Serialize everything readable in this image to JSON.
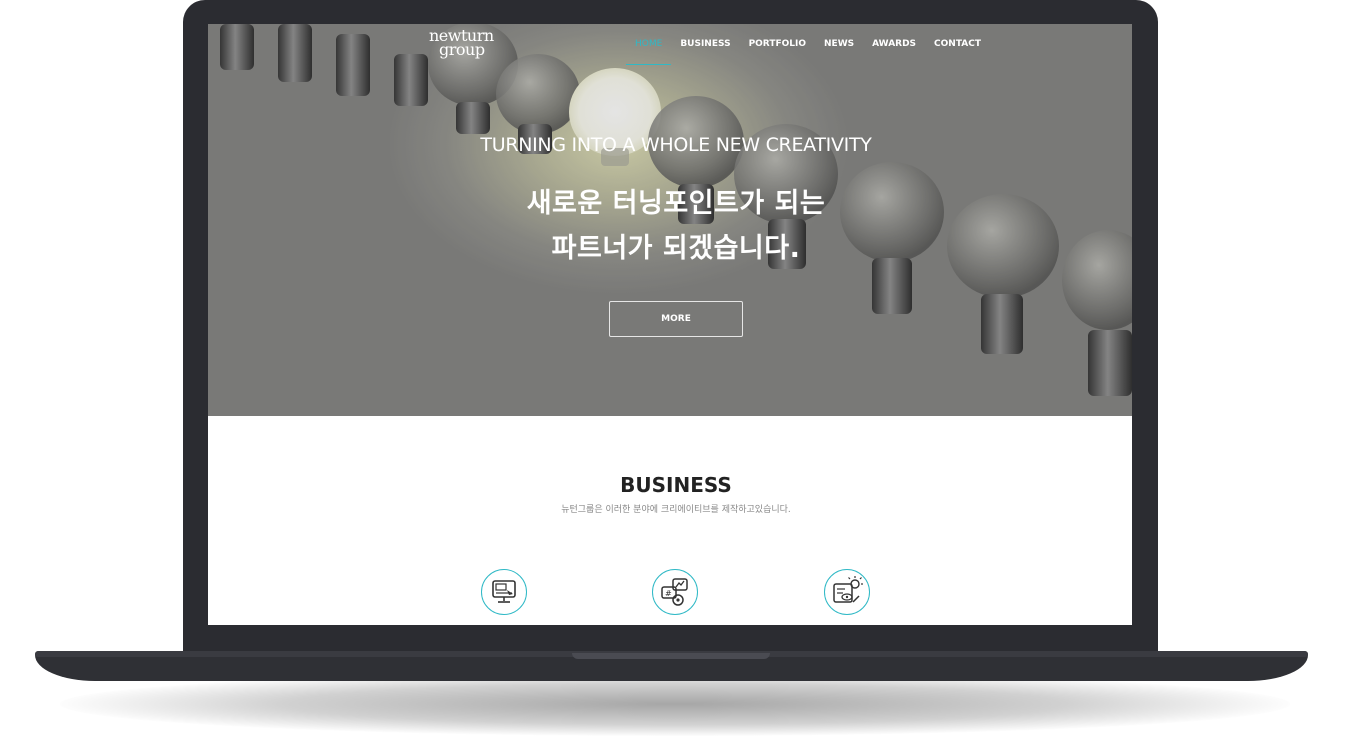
{
  "brand": {
    "line1": "newturn",
    "line2": "group"
  },
  "nav": {
    "items": [
      {
        "label": "HOME",
        "active": true
      },
      {
        "label": "BUSINESS",
        "active": false
      },
      {
        "label": "PORTFOLIO",
        "active": false
      },
      {
        "label": "NEWS",
        "active": false
      },
      {
        "label": "AWARDS",
        "active": false
      },
      {
        "label": "CONTACT",
        "active": false
      }
    ]
  },
  "hero": {
    "tagline": "TURNING INTO A WHOLE NEW CREATIVITY",
    "headline_line1": "새로운 터닝포인트가 되는",
    "headline_line2": "파트너가 되겠습니다.",
    "more_label": "MORE"
  },
  "business": {
    "title": "BUSINESS",
    "subtitle": "뉴턴그룹은 이러한 분야에 크리에이티브를 제작하고있습니다.",
    "icons": [
      "web-design-icon",
      "marketing-icon",
      "creative-icon"
    ]
  },
  "colors": {
    "accent": "#2fb9c6",
    "frame": "#2b2c31"
  }
}
